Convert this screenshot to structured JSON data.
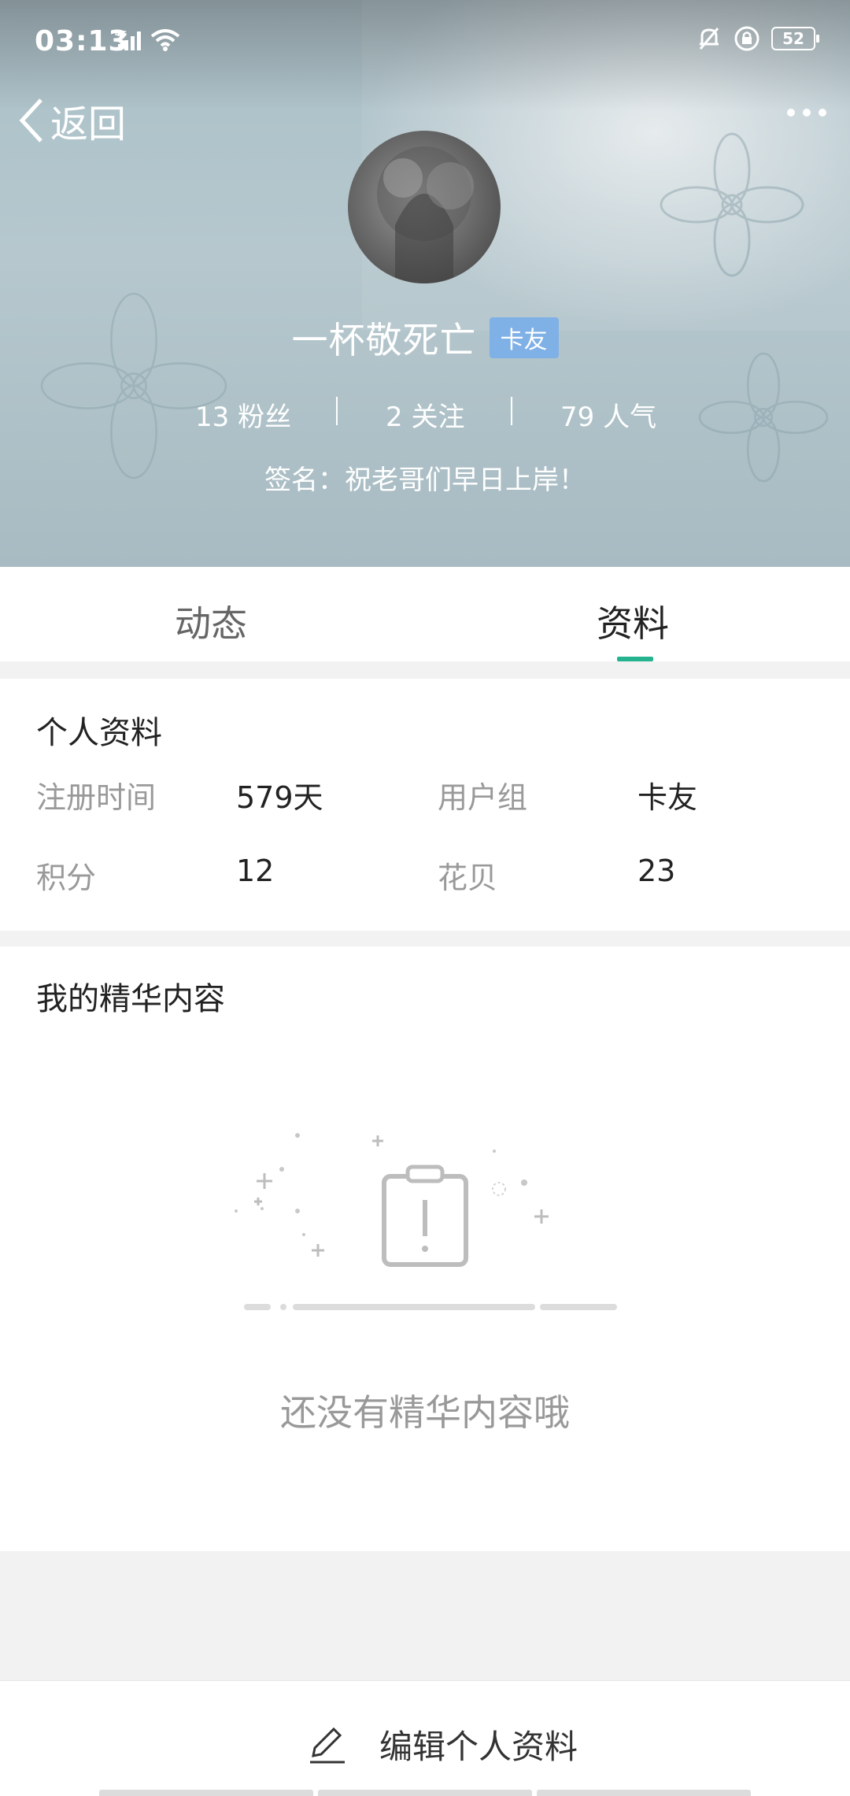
{
  "status_bar": {
    "time": "03:13",
    "signal_label": "4G",
    "battery": "52"
  },
  "nav": {
    "back_label": "返回",
    "more_icon": "more-dots-icon"
  },
  "profile": {
    "username": "一杯敬死亡",
    "group_badge": "卡友",
    "stats": [
      {
        "text": "13 粉丝"
      },
      {
        "text": "2 关注"
      },
      {
        "text": "79 人气"
      }
    ],
    "signature": "签名：祝老哥们早日上岸！"
  },
  "tabs": [
    {
      "label": "动态",
      "active": false
    },
    {
      "label": "资料",
      "active": true
    }
  ],
  "personal_info": {
    "title": "个人资料",
    "rows": [
      {
        "label1": "注册时间",
        "value1": "579天",
        "label2": "用户组",
        "value2": "卡友"
      },
      {
        "label1": "积分",
        "value1": "12",
        "label2": "花贝",
        "value2": "23"
      }
    ]
  },
  "essence": {
    "title": "我的精华内容",
    "empty_text": "还没有精华内容哦"
  },
  "bottom": {
    "edit_label": "编辑个人资料"
  },
  "colors": {
    "accent": "#25b38f",
    "badge": "#7fb0e6"
  }
}
